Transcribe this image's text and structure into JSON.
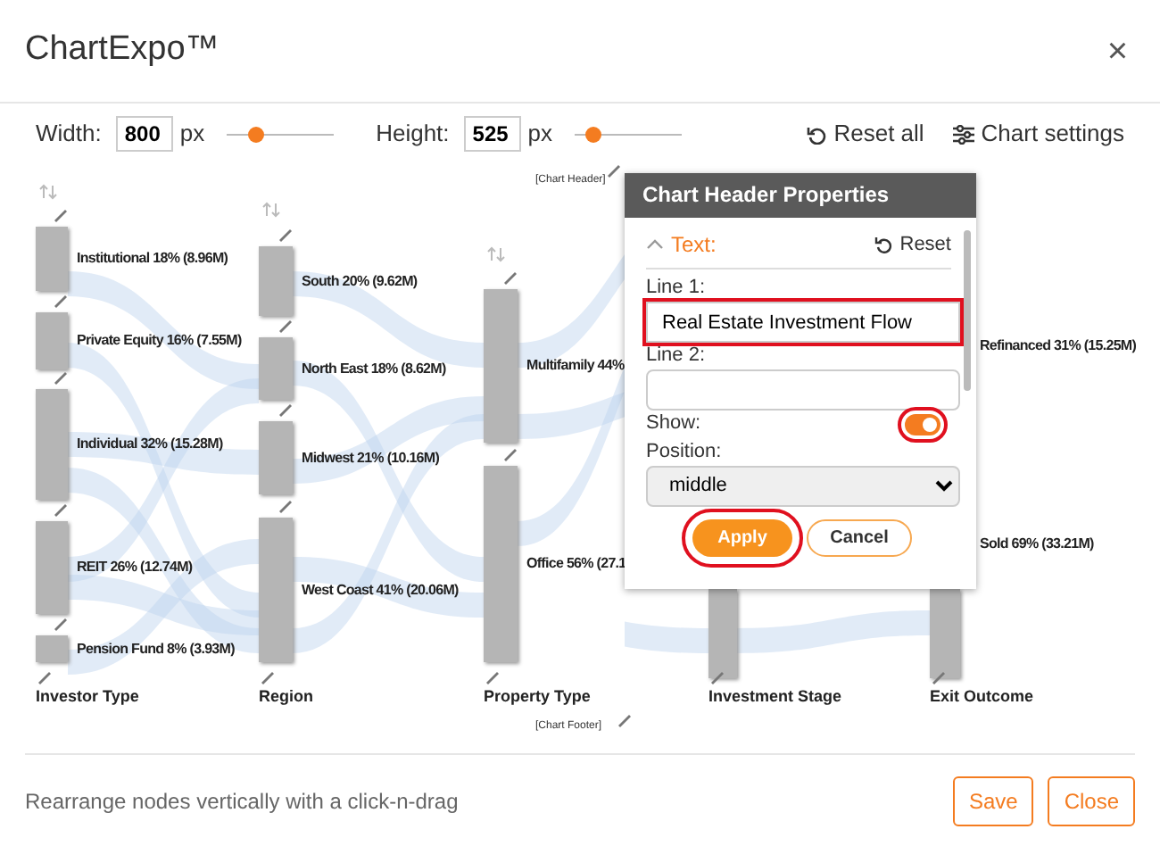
{
  "window": {
    "title": "ChartExpo™",
    "close": "×"
  },
  "toolbar": {
    "width_label": "Width:",
    "width_value": "800",
    "width_unit": "px",
    "width_slider": {
      "level": 0.28
    },
    "height_label": "Height:",
    "height_value": "525",
    "height_unit": "px",
    "height_slider": {
      "level": 0.18
    },
    "reset_all": "Reset all",
    "chart_settings": "Chart settings"
  },
  "chart": {
    "header": "[Chart Header]",
    "footer": "[Chart Footer]",
    "columns": [
      {
        "axis_label": "Investor Type",
        "sortable": true,
        "nodes": [
          {
            "kind": "bar",
            "label": "Institutional 18% (8.96M)"
          },
          {
            "kind": "bar",
            "label": "Private Equity 16% (7.55M)"
          },
          {
            "kind": "bar",
            "label": "Individual 32% (15.28M)"
          },
          {
            "kind": "bar",
            "label": "REIT 26% (12.74M)"
          },
          {
            "kind": "bar",
            "label": "Pension Fund 8% (3.93M)"
          }
        ]
      },
      {
        "axis_label": "Region",
        "sortable": true,
        "nodes": [
          {
            "kind": "bar",
            "label": "South 20% (9.62M)"
          },
          {
            "kind": "bar",
            "label": "North East 18% (8.62M)"
          },
          {
            "kind": "bar",
            "label": "Midwest 21% (10.16M)"
          },
          {
            "kind": "bar",
            "label": "West Coast 41% (20.06M)"
          }
        ]
      },
      {
        "axis_label": "Property Type",
        "sortable": true,
        "nodes": [
          {
            "kind": "bar",
            "label": "Multifamily 44%"
          },
          {
            "kind": "bar",
            "label": "Office 56% (27.1"
          }
        ]
      },
      {
        "axis_label": "Investment Stage",
        "sortable": false,
        "nodes": [
          {
            "kind": "bar"
          }
        ]
      },
      {
        "axis_label": "Exit Outcome",
        "sortable": false,
        "nodes": [
          {
            "kind": "label-only",
            "label": "Refinanced 31% (15.25M)"
          },
          {
            "kind": "bar",
            "label": "Sold 69% (33.21M)"
          }
        ]
      }
    ]
  },
  "popup": {
    "title": "Chart Header Properties",
    "section": "Text:",
    "expanded": true,
    "reset": "Reset",
    "fields": [
      {
        "kind": "text",
        "label": "Line 1:",
        "value": "Real Estate Investment Flow",
        "highlighted": true
      },
      {
        "kind": "text",
        "label": "Line 2:",
        "highlighted": false
      },
      {
        "kind": "toggle",
        "label": "Show:",
        "on": true,
        "highlighted": true
      },
      {
        "kind": "select",
        "label": "Position:",
        "value": "middle",
        "highlighted": false
      }
    ],
    "apply": {
      "label": "Apply",
      "highlighted": true
    },
    "cancel": "Cancel"
  },
  "footer": {
    "hint": "Rearrange nodes vertically with a click-n-drag",
    "buttons": [
      "Save",
      "Close"
    ]
  }
}
